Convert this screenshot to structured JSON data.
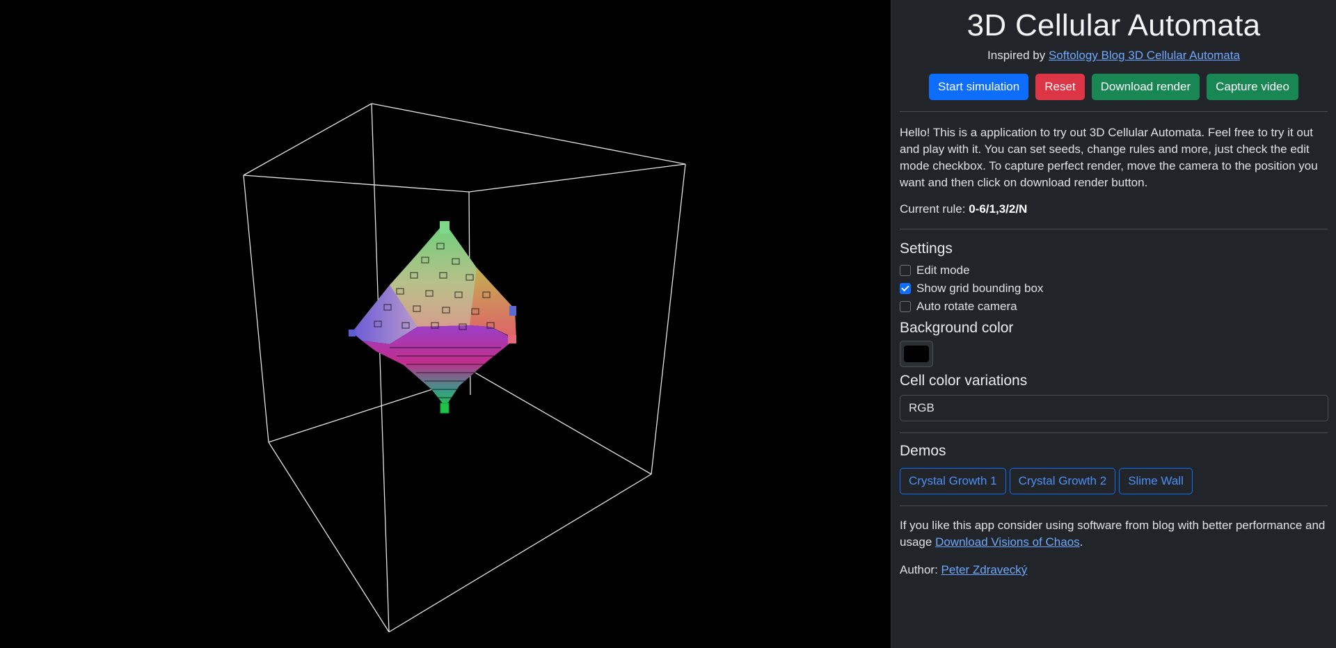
{
  "page": {
    "title": "3D Cellular Automata",
    "inspired_prefix": "Inspired by",
    "inspired_link": "Softology Blog 3D Cellular Automata"
  },
  "toolbar": {
    "start_label": "Start simulation",
    "reset_label": "Reset",
    "download_label": "Download render",
    "capture_label": "Capture video"
  },
  "intro": {
    "text": "Hello! This is a application to try out 3D Cellular Automata. Feel free to try it out and play with it. You can set seeds, change rules and more, just check the edit mode checkbox. To capture perfect render, move the camera to the position you want and then click on download render button.",
    "rule_label": "Current rule:",
    "rule_value": "0-6/1,3/2/N"
  },
  "settings": {
    "heading": "Settings",
    "options": [
      {
        "label": "Edit mode",
        "checked": false
      },
      {
        "label": "Show grid bounding box",
        "checked": true
      },
      {
        "label": "Auto rotate camera",
        "checked": false
      }
    ],
    "bg_heading": "Background color",
    "bg_color": "#000000",
    "cell_heading": "Cell color variations",
    "cell_value": "RGB"
  },
  "demos": {
    "heading": "Demos",
    "items": [
      "Crystal Growth 1",
      "Crystal Growth 2",
      "Slime Wall"
    ]
  },
  "footer": {
    "text_before": "If you like this app consider using software from blog with better performance and usage",
    "link": "Download Visions of Chaos",
    "text_after": ".",
    "author_label": "Author:",
    "author_name": "Peter Zdravecký"
  },
  "colors": {
    "panel_bg": "#212529",
    "primary": "#0d6efd",
    "danger": "#dc3545",
    "success": "#198754",
    "link": "#6ea8fe"
  }
}
